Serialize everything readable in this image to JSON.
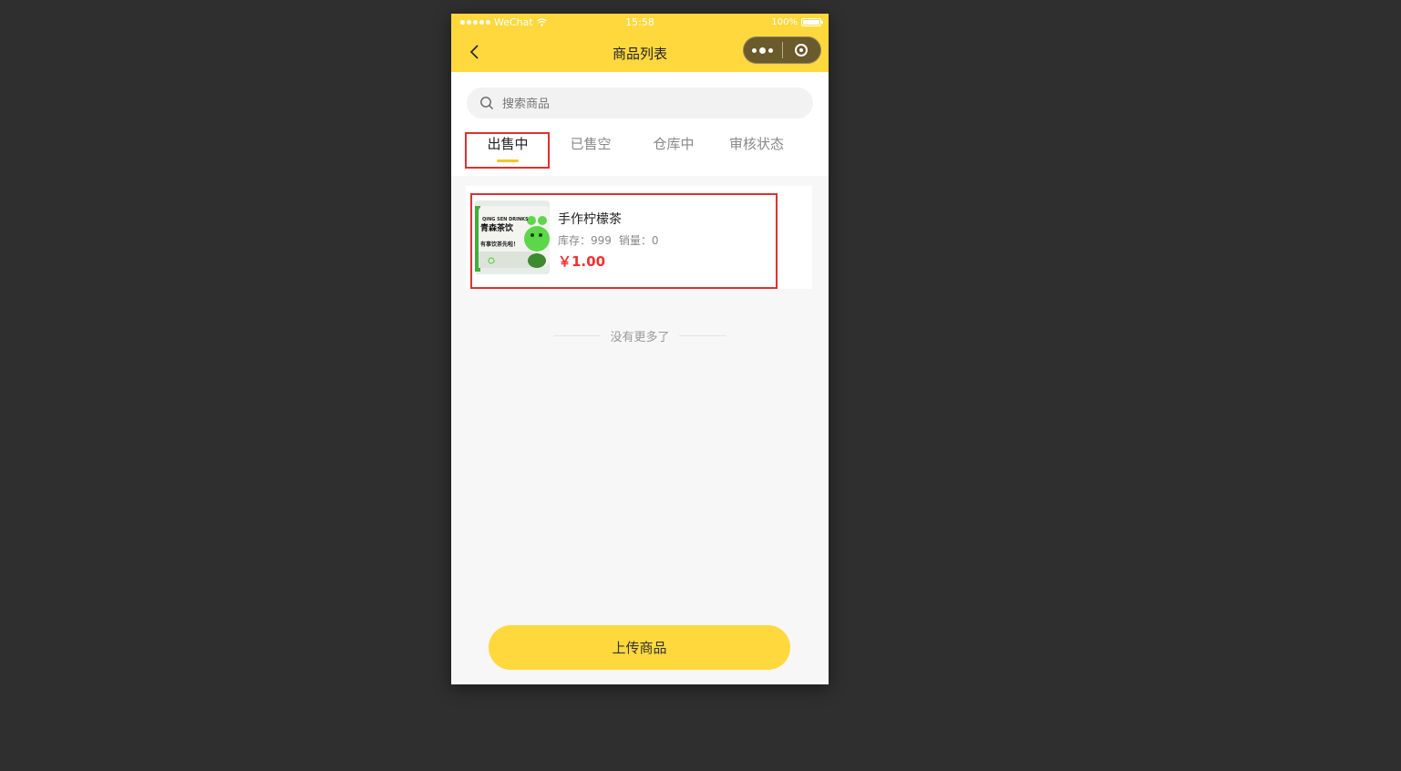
{
  "status_bar": {
    "carrier": "WeChat",
    "time": "15:58",
    "battery": "100%"
  },
  "nav": {
    "title": "商品列表",
    "back_icon": "chevron-left-icon",
    "menu_icon": "more-dots-icon",
    "close_icon": "target-circle-icon"
  },
  "search": {
    "placeholder": "搜索商品",
    "value": ""
  },
  "tabs": [
    {
      "label": "出售中",
      "active": true
    },
    {
      "label": "已售空",
      "active": false
    },
    {
      "label": "仓库中",
      "active": false
    },
    {
      "label": "审核状态",
      "active": false
    }
  ],
  "products": [
    {
      "name": "手作柠檬茶",
      "stock_label": "库存：999",
      "sales_label": "销量：0",
      "price": "￥1.00",
      "thumb_texts": [
        "QING SEN DRINKS",
        "青森茶饮",
        "有事饮茶先啦！"
      ]
    }
  ],
  "list_end_text": "没有更多了",
  "upload_button": "上传商品",
  "colors": {
    "brand_yellow": "#ffd83d",
    "price_red": "#f23030",
    "highlight_red": "#e03030",
    "tab_indicator": "#f4c62d"
  }
}
